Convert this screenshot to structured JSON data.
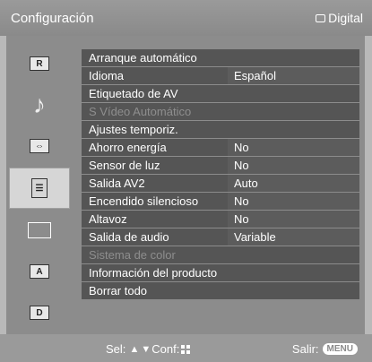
{
  "header": {
    "title": "Configuración",
    "right_label": "Digital"
  },
  "sidebar": {
    "items": [
      {
        "icon": "picture-icon",
        "symbol": "▣"
      },
      {
        "icon": "music-note-icon",
        "symbol": "♪"
      },
      {
        "icon": "screen-icon",
        "symbol": "▭"
      },
      {
        "icon": "settings-list-icon",
        "symbol": "☰"
      },
      {
        "icon": "monitor-icon",
        "symbol": "▭"
      },
      {
        "icon": "analog-tuning-icon",
        "symbol": "A"
      },
      {
        "icon": "digital-tuning-icon",
        "symbol": "D"
      }
    ]
  },
  "menu": {
    "rows": [
      {
        "label": "Arranque automático",
        "value": ""
      },
      {
        "label": "Idioma",
        "value": "Español"
      },
      {
        "label": "Etiquetado de AV",
        "value": ""
      },
      {
        "label": "S Vídeo Automático",
        "value": ""
      },
      {
        "label": "Ajustes temporiz.",
        "value": ""
      },
      {
        "label": "Ahorro energía",
        "value": "No"
      },
      {
        "label": "Sensor de luz",
        "value": "No"
      },
      {
        "label": "Salida AV2",
        "value": "Auto"
      },
      {
        "label": "Encendido silencioso",
        "value": "No"
      },
      {
        "label": "Altavoz",
        "value": "No"
      },
      {
        "label": "Salida de audio",
        "value": "Variable"
      },
      {
        "label": "Sistema de color",
        "value": ""
      },
      {
        "label": "Información del producto",
        "value": ""
      },
      {
        "label": "Borrar todo",
        "value": ""
      }
    ]
  },
  "footer": {
    "sel_label": "Sel:",
    "conf_label": "Conf:",
    "exit_label": "Salir:",
    "menu_button": "MENU"
  }
}
